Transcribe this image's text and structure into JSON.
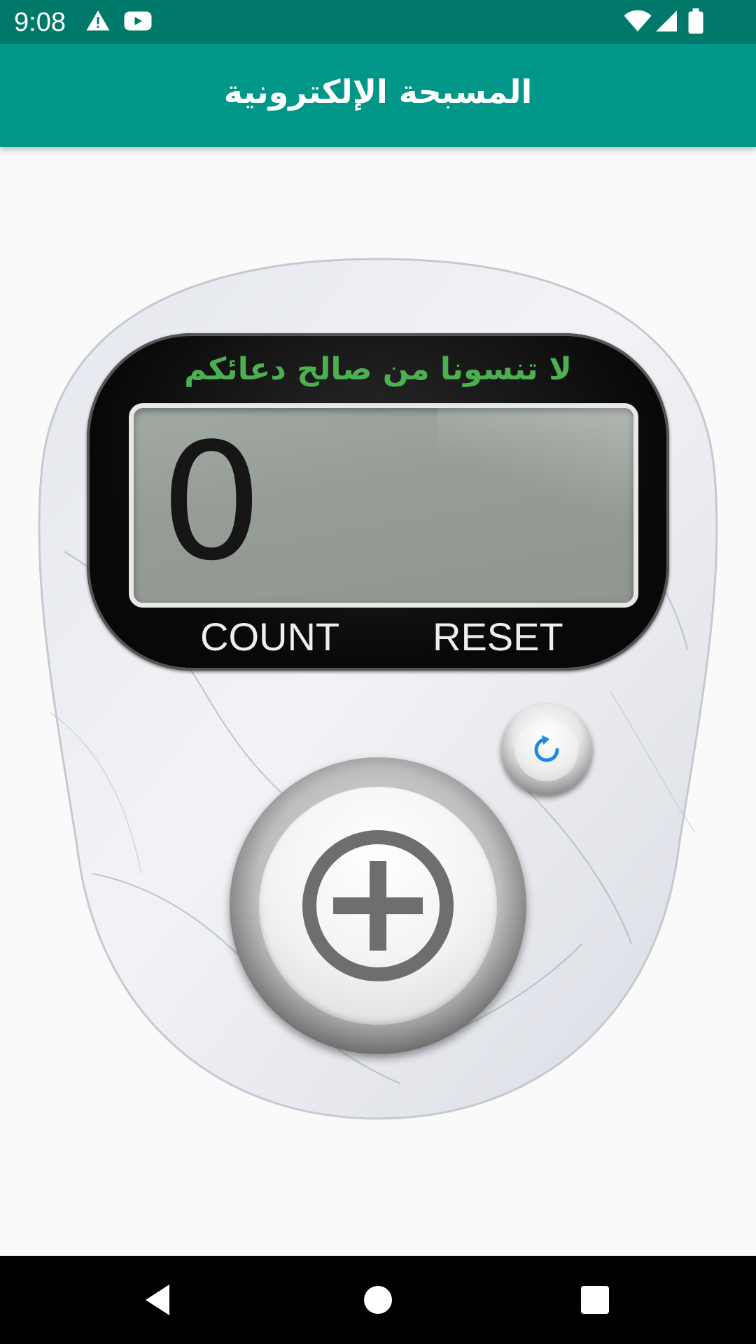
{
  "status_bar": {
    "time": "9:08",
    "icons": [
      "warning-icon",
      "youtube-icon",
      "wifi-icon",
      "signal-icon",
      "battery-icon"
    ]
  },
  "app_bar": {
    "title": "المسبحة الإلكترونية"
  },
  "counter": {
    "dua": "لا تنسونا من صالح دعائكم",
    "count": "0",
    "count_label": "COUNT",
    "reset_label": "RESET",
    "reset_icon": "refresh-icon",
    "plus_icon": "plus-circle-icon"
  },
  "nav_bar": {
    "icons": [
      "back-icon",
      "home-icon",
      "recents-icon"
    ]
  },
  "colors": {
    "status_bar": "#00796b",
    "app_bar": "#009688",
    "dua_text": "#4caf50",
    "reset_icon": "#1e88e5",
    "plus_icon": "#6e6e6e"
  }
}
